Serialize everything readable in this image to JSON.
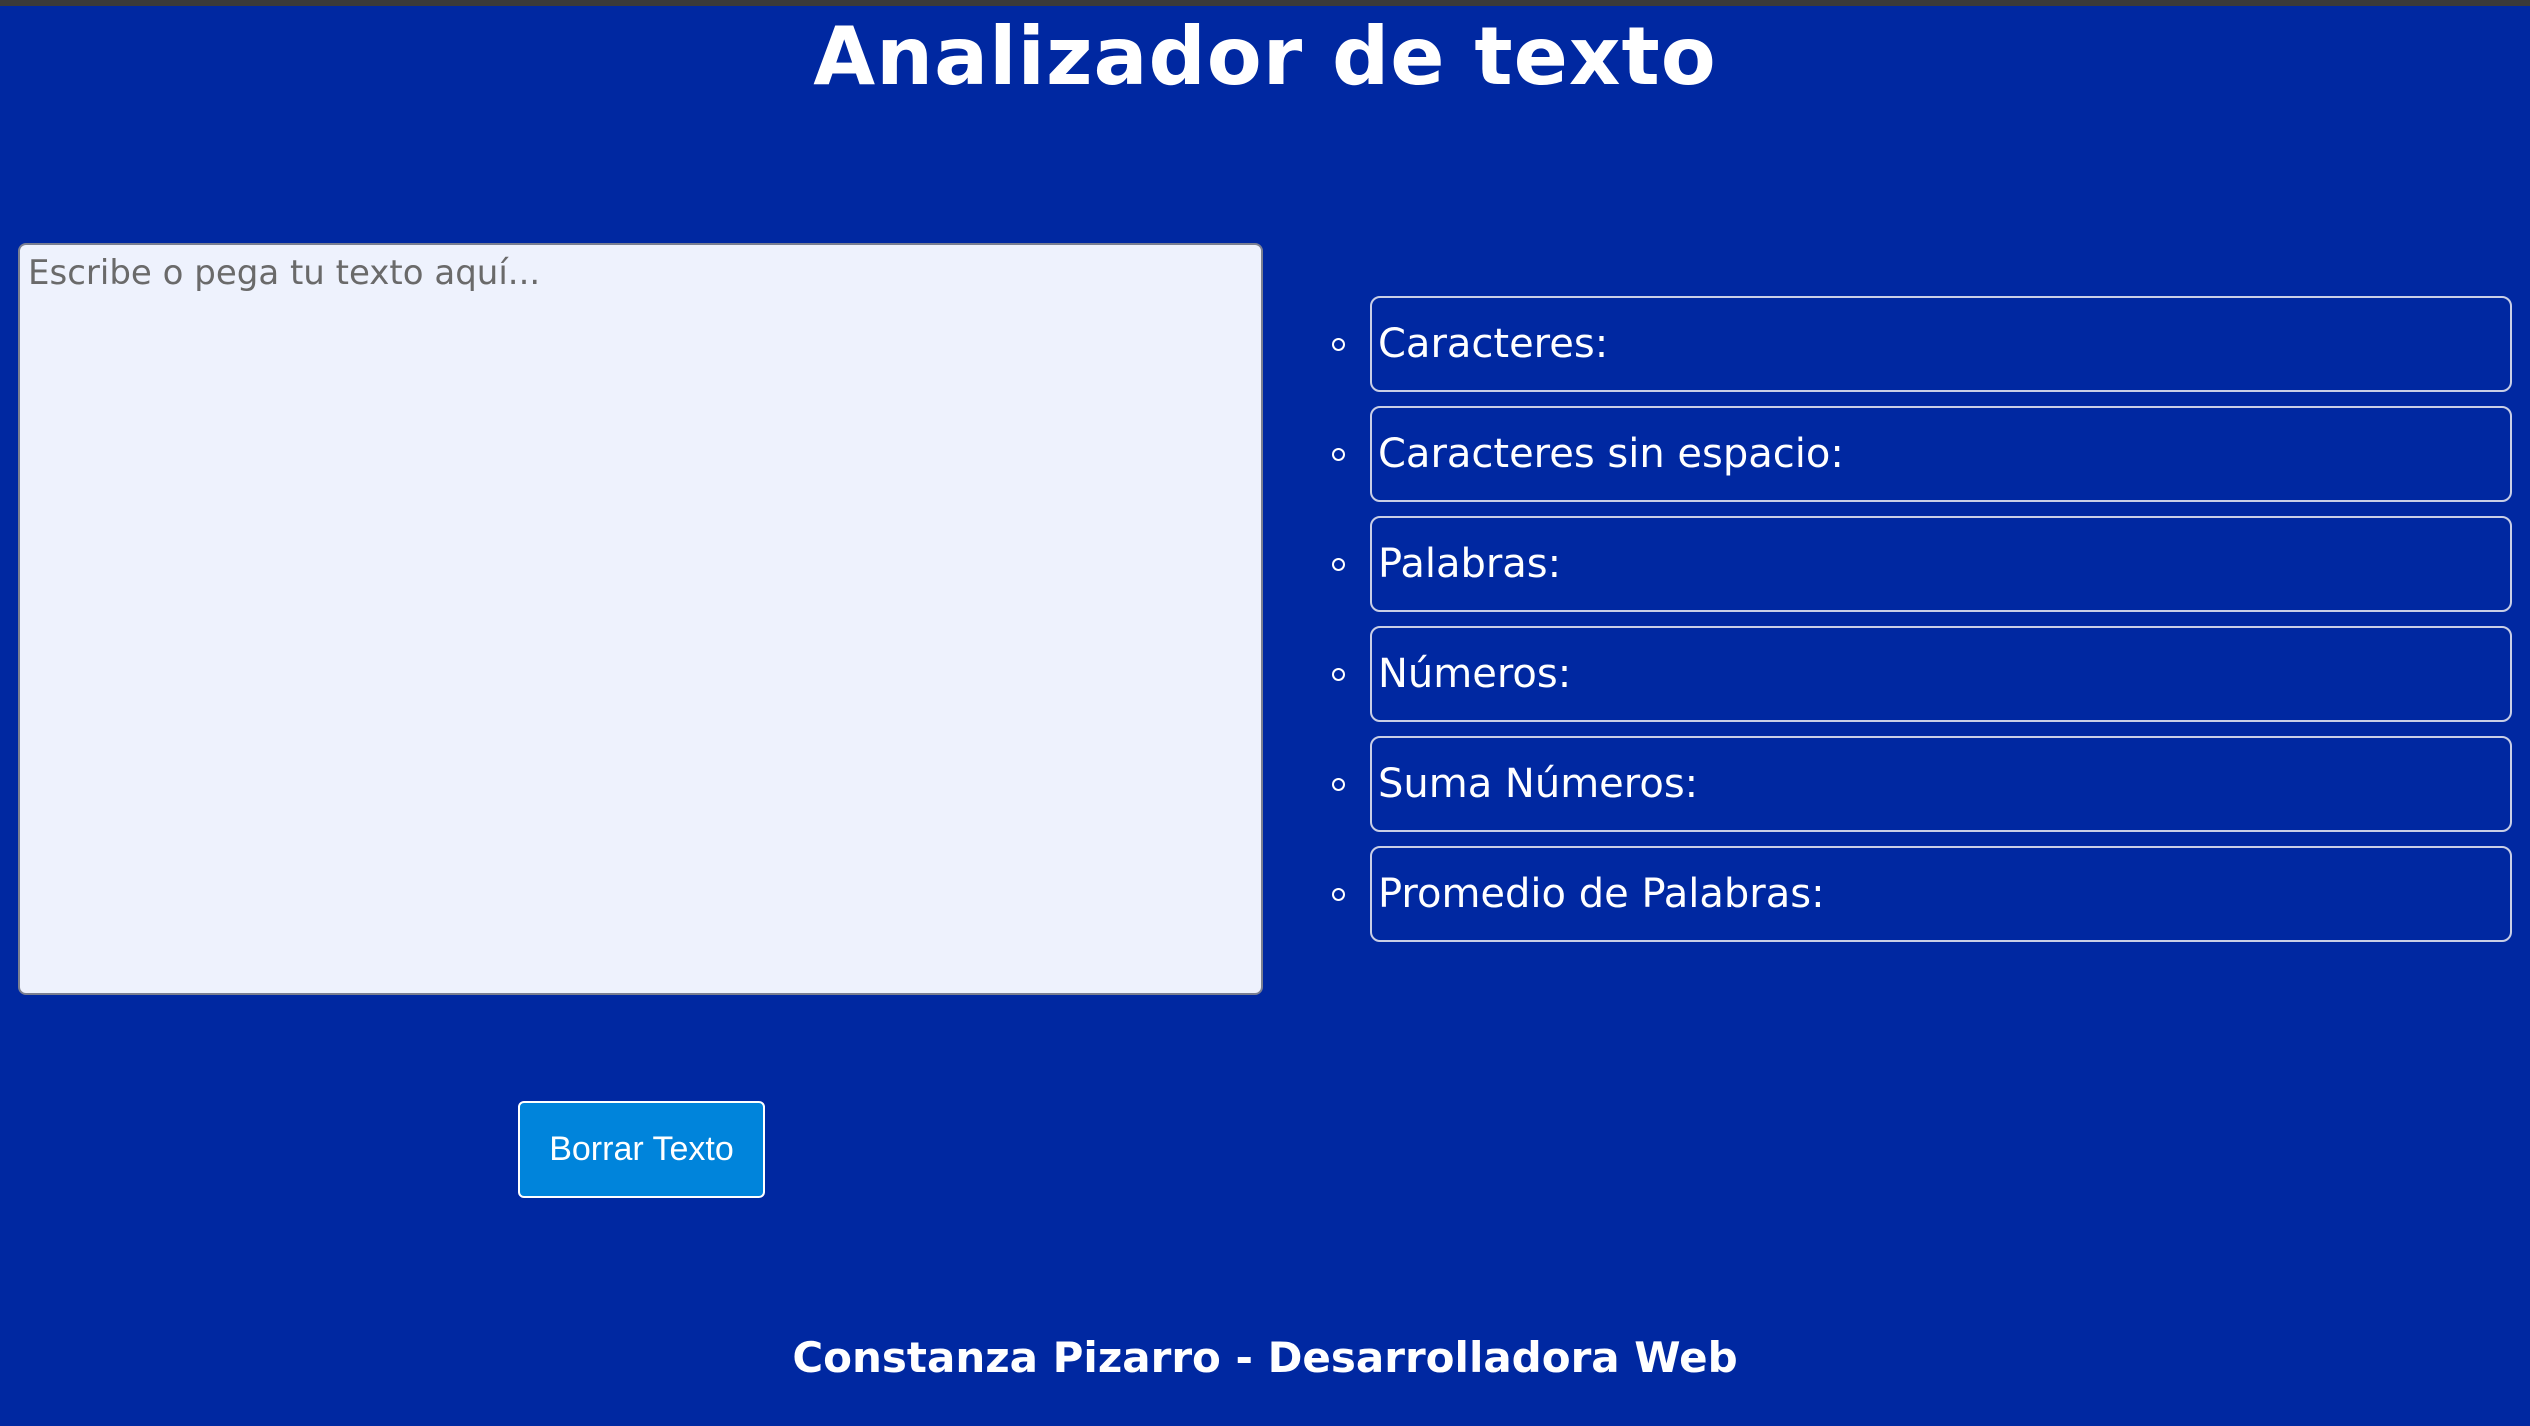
{
  "header": {
    "title": "Analizador de texto"
  },
  "editor": {
    "placeholder": "Escribe o pega tu texto aquí...",
    "value": ""
  },
  "clear_button": {
    "label": "Borrar Texto"
  },
  "stats": [
    {
      "label": "Caracteres:"
    },
    {
      "label": "Caracteres sin espacio:"
    },
    {
      "label": "Palabras:"
    },
    {
      "label": "Números:"
    },
    {
      "label": "Suma Números:"
    },
    {
      "label": "Promedio de Palabras:"
    }
  ],
  "footer": {
    "text": "Constanza Pizarro - Desarrolladora Web"
  },
  "colors": {
    "background": "#0028a1",
    "textarea_bg": "#eef2fd",
    "button_bg": "#0084db",
    "text": "#ffffff"
  }
}
